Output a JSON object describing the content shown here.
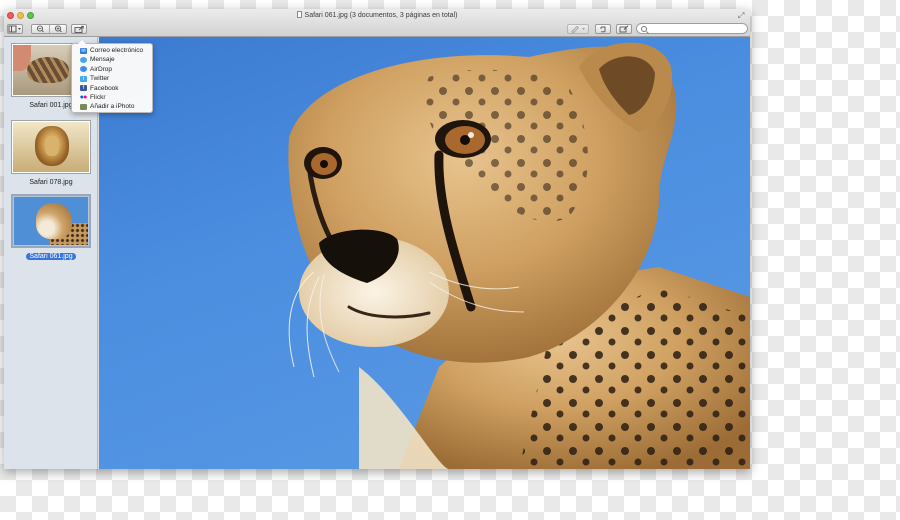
{
  "window": {
    "title": "Safari 061.jpg (3 documentos, 3 páginas en total)",
    "doc_icon": "document-icon",
    "fullscreen_icon": "fullscreen-arrows-icon"
  },
  "toolbar": {
    "view_button_icon": "sidebar-view-icon",
    "zoom_out_icon": "zoom-out-icon",
    "zoom_in_icon": "zoom-in-icon",
    "share_icon": "share-icon",
    "annotate_icon": "pencil-icon",
    "rotate_icon": "rotate-icon",
    "edit_icon": "edit-markup-icon",
    "search_placeholder": ""
  },
  "share_menu": {
    "items": [
      {
        "label": "Correo electrónico",
        "icon": "mail-icon",
        "color": "#2d7de0"
      },
      {
        "label": "Mensaje",
        "icon": "messages-icon",
        "color": "#4aa3f0"
      },
      {
        "label": "AirDrop",
        "icon": "airdrop-icon",
        "color": "#3c8fe6"
      },
      {
        "label": "Twitter",
        "icon": "twitter-icon",
        "color": "#3fa9f5"
      },
      {
        "label": "Facebook",
        "icon": "facebook-icon",
        "color": "#3b5998"
      },
      {
        "label": "Flickr",
        "icon": "flickr-icon",
        "color": "#ff0084"
      },
      {
        "label": "Añadir a iPhoto",
        "icon": "iphoto-icon",
        "color": "#7c8a5a"
      }
    ]
  },
  "sidebar": {
    "thumbnails": [
      {
        "caption": "Safari 001.jpg",
        "selected": false
      },
      {
        "caption": "Safari 078.jpg",
        "selected": false
      },
      {
        "caption": "Safari 061.jpg",
        "selected": true
      }
    ]
  },
  "colors": {
    "selection": "#3875d7",
    "sky": "#4b8ee0"
  }
}
